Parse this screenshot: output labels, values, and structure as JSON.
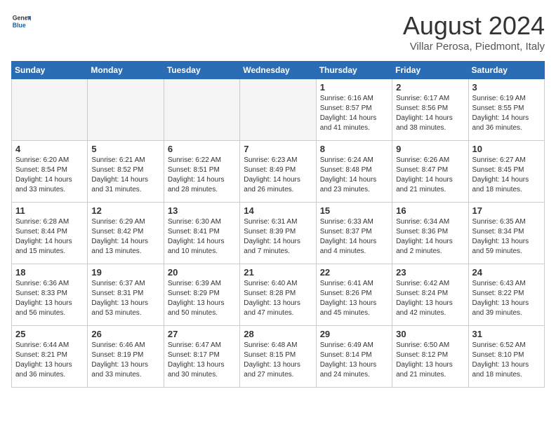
{
  "header": {
    "logo_general": "General",
    "logo_blue": "Blue",
    "month_year": "August 2024",
    "location": "Villar Perosa, Piedmont, Italy"
  },
  "weekdays": [
    "Sunday",
    "Monday",
    "Tuesday",
    "Wednesday",
    "Thursday",
    "Friday",
    "Saturday"
  ],
  "weeks": [
    [
      {
        "day": "",
        "info": ""
      },
      {
        "day": "",
        "info": ""
      },
      {
        "day": "",
        "info": ""
      },
      {
        "day": "",
        "info": ""
      },
      {
        "day": "1",
        "info": "Sunrise: 6:16 AM\nSunset: 8:57 PM\nDaylight: 14 hours\nand 41 minutes."
      },
      {
        "day": "2",
        "info": "Sunrise: 6:17 AM\nSunset: 8:56 PM\nDaylight: 14 hours\nand 38 minutes."
      },
      {
        "day": "3",
        "info": "Sunrise: 6:19 AM\nSunset: 8:55 PM\nDaylight: 14 hours\nand 36 minutes."
      }
    ],
    [
      {
        "day": "4",
        "info": "Sunrise: 6:20 AM\nSunset: 8:54 PM\nDaylight: 14 hours\nand 33 minutes."
      },
      {
        "day": "5",
        "info": "Sunrise: 6:21 AM\nSunset: 8:52 PM\nDaylight: 14 hours\nand 31 minutes."
      },
      {
        "day": "6",
        "info": "Sunrise: 6:22 AM\nSunset: 8:51 PM\nDaylight: 14 hours\nand 28 minutes."
      },
      {
        "day": "7",
        "info": "Sunrise: 6:23 AM\nSunset: 8:49 PM\nDaylight: 14 hours\nand 26 minutes."
      },
      {
        "day": "8",
        "info": "Sunrise: 6:24 AM\nSunset: 8:48 PM\nDaylight: 14 hours\nand 23 minutes."
      },
      {
        "day": "9",
        "info": "Sunrise: 6:26 AM\nSunset: 8:47 PM\nDaylight: 14 hours\nand 21 minutes."
      },
      {
        "day": "10",
        "info": "Sunrise: 6:27 AM\nSunset: 8:45 PM\nDaylight: 14 hours\nand 18 minutes."
      }
    ],
    [
      {
        "day": "11",
        "info": "Sunrise: 6:28 AM\nSunset: 8:44 PM\nDaylight: 14 hours\nand 15 minutes."
      },
      {
        "day": "12",
        "info": "Sunrise: 6:29 AM\nSunset: 8:42 PM\nDaylight: 14 hours\nand 13 minutes."
      },
      {
        "day": "13",
        "info": "Sunrise: 6:30 AM\nSunset: 8:41 PM\nDaylight: 14 hours\nand 10 minutes."
      },
      {
        "day": "14",
        "info": "Sunrise: 6:31 AM\nSunset: 8:39 PM\nDaylight: 14 hours\nand 7 minutes."
      },
      {
        "day": "15",
        "info": "Sunrise: 6:33 AM\nSunset: 8:37 PM\nDaylight: 14 hours\nand 4 minutes."
      },
      {
        "day": "16",
        "info": "Sunrise: 6:34 AM\nSunset: 8:36 PM\nDaylight: 14 hours\nand 2 minutes."
      },
      {
        "day": "17",
        "info": "Sunrise: 6:35 AM\nSunset: 8:34 PM\nDaylight: 13 hours\nand 59 minutes."
      }
    ],
    [
      {
        "day": "18",
        "info": "Sunrise: 6:36 AM\nSunset: 8:33 PM\nDaylight: 13 hours\nand 56 minutes."
      },
      {
        "day": "19",
        "info": "Sunrise: 6:37 AM\nSunset: 8:31 PM\nDaylight: 13 hours\nand 53 minutes."
      },
      {
        "day": "20",
        "info": "Sunrise: 6:39 AM\nSunset: 8:29 PM\nDaylight: 13 hours\nand 50 minutes."
      },
      {
        "day": "21",
        "info": "Sunrise: 6:40 AM\nSunset: 8:28 PM\nDaylight: 13 hours\nand 47 minutes."
      },
      {
        "day": "22",
        "info": "Sunrise: 6:41 AM\nSunset: 8:26 PM\nDaylight: 13 hours\nand 45 minutes."
      },
      {
        "day": "23",
        "info": "Sunrise: 6:42 AM\nSunset: 8:24 PM\nDaylight: 13 hours\nand 42 minutes."
      },
      {
        "day": "24",
        "info": "Sunrise: 6:43 AM\nSunset: 8:22 PM\nDaylight: 13 hours\nand 39 minutes."
      }
    ],
    [
      {
        "day": "25",
        "info": "Sunrise: 6:44 AM\nSunset: 8:21 PM\nDaylight: 13 hours\nand 36 minutes."
      },
      {
        "day": "26",
        "info": "Sunrise: 6:46 AM\nSunset: 8:19 PM\nDaylight: 13 hours\nand 33 minutes."
      },
      {
        "day": "27",
        "info": "Sunrise: 6:47 AM\nSunset: 8:17 PM\nDaylight: 13 hours\nand 30 minutes."
      },
      {
        "day": "28",
        "info": "Sunrise: 6:48 AM\nSunset: 8:15 PM\nDaylight: 13 hours\nand 27 minutes."
      },
      {
        "day": "29",
        "info": "Sunrise: 6:49 AM\nSunset: 8:14 PM\nDaylight: 13 hours\nand 24 minutes."
      },
      {
        "day": "30",
        "info": "Sunrise: 6:50 AM\nSunset: 8:12 PM\nDaylight: 13 hours\nand 21 minutes."
      },
      {
        "day": "31",
        "info": "Sunrise: 6:52 AM\nSunset: 8:10 PM\nDaylight: 13 hours\nand 18 minutes."
      }
    ]
  ]
}
